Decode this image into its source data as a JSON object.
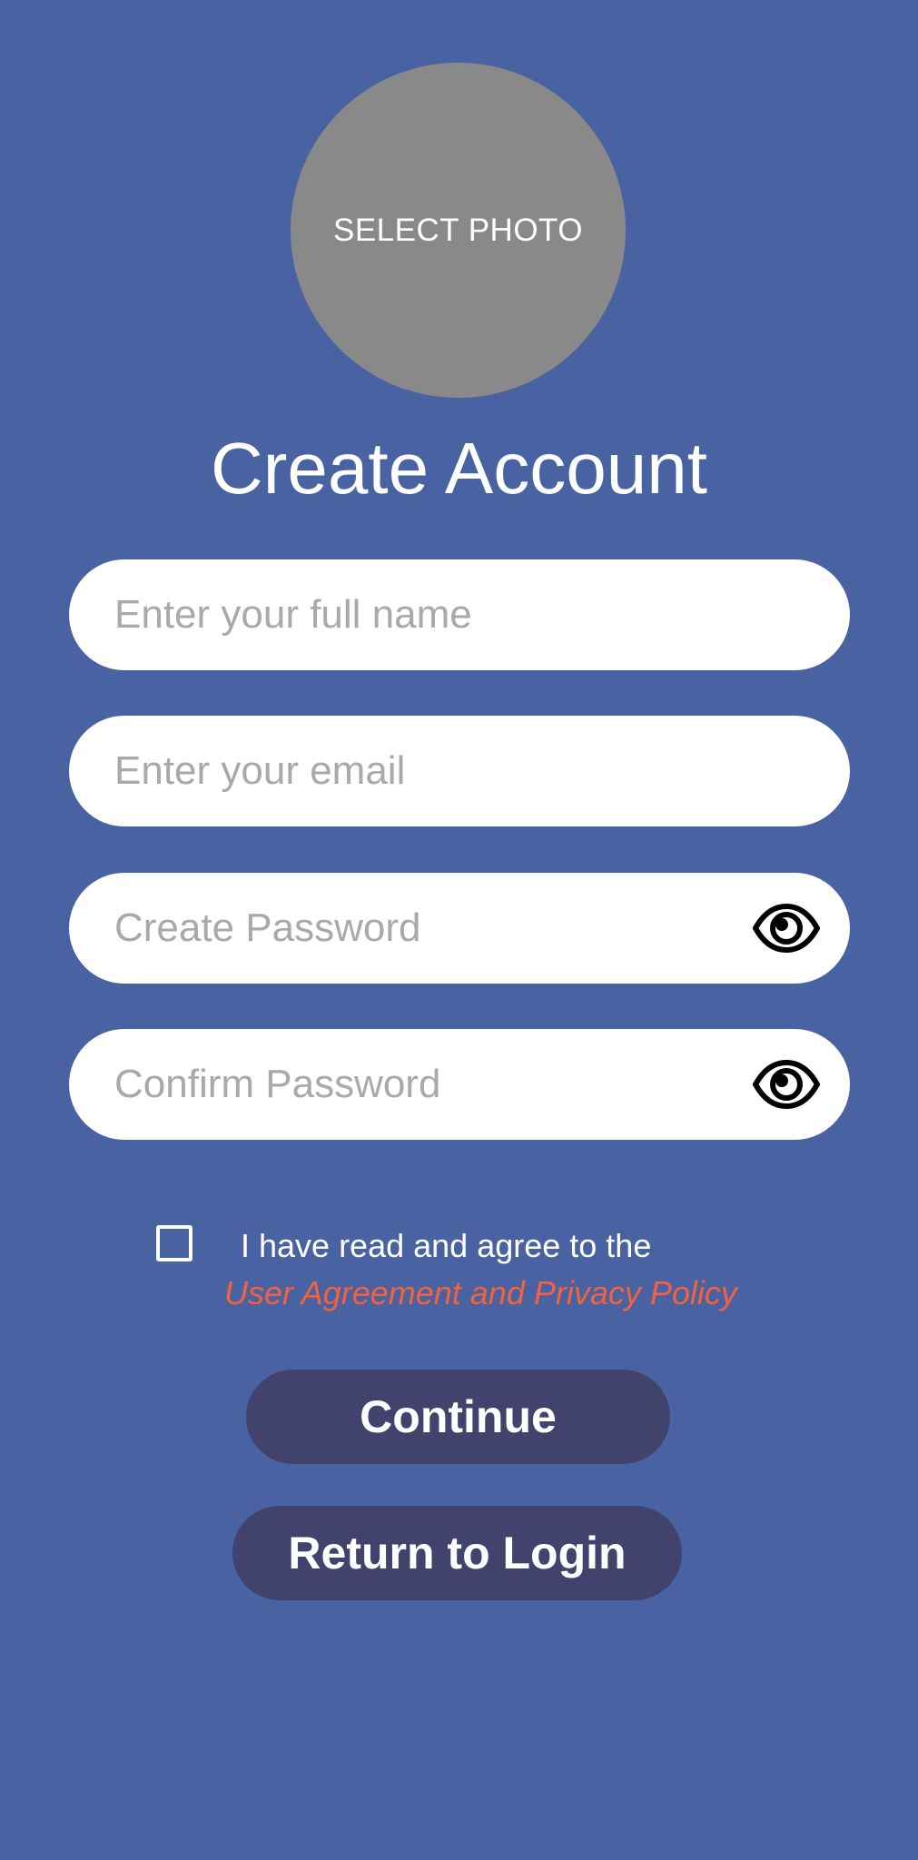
{
  "photo": {
    "label": "SELECT PHOTO"
  },
  "title": "Create Account",
  "fields": {
    "full_name": {
      "placeholder": "Enter your full name",
      "value": ""
    },
    "email": {
      "placeholder": "Enter your email",
      "value": ""
    },
    "password": {
      "placeholder": "Create Password",
      "value": "",
      "toggle_icon": "eye-icon"
    },
    "confirm_password": {
      "placeholder": "Confirm Password",
      "value": "",
      "toggle_icon": "eye-icon"
    }
  },
  "agreement": {
    "checked": false,
    "text": "I have read and agree to the",
    "link": "User Agreement and Privacy Policy"
  },
  "buttons": {
    "continue": "Continue",
    "return_login": "Return to Login"
  },
  "colors": {
    "background": "#4963a2",
    "photo": "#898989",
    "button": "#41436c",
    "link": "#f3623e"
  }
}
